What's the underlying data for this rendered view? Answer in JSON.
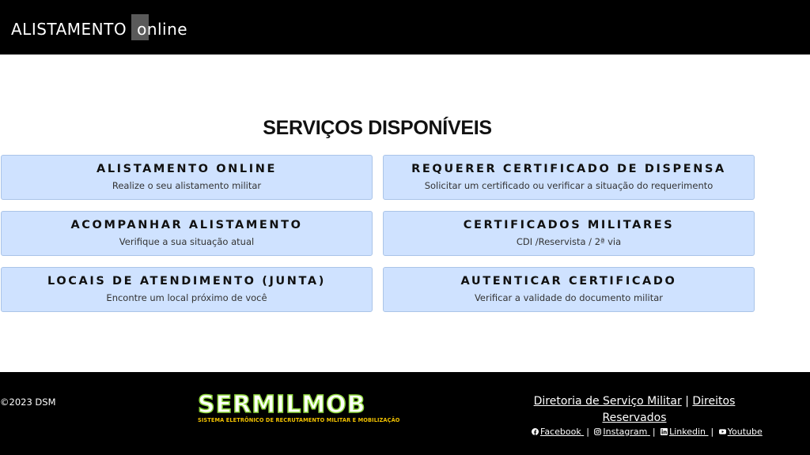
{
  "header": {
    "brand_main": "ALISTAMENTO",
    "brand_online": "online"
  },
  "main": {
    "section_title": "SERVIÇOS DISPONÍVEIS",
    "services": [
      {
        "title": "ALISTAMENTO ONLINE",
        "subtitle": "Realize o seu alistamento militar"
      },
      {
        "title": "REQUERER CERTIFICADO DE DISPENSA",
        "subtitle": "Solicitar um certificado ou verificar a situação do requerimento"
      },
      {
        "title": "ACOMPANHAR ALISTAMENTO",
        "subtitle": "Verifique a sua situação atual"
      },
      {
        "title": "CERTIFICADOS MILITARES",
        "subtitle": "CDI /Reservista / 2ª via"
      },
      {
        "title": "LOCAIS DE ATENDIMENTO (JUNTA)",
        "subtitle": "Encontre um local próximo de você"
      },
      {
        "title": "AUTENTICAR CERTIFICADO",
        "subtitle": "Verificar a validade do documento militar"
      }
    ]
  },
  "footer": {
    "copyright": "©2023 DSM",
    "logo_text": "SERMILMOB",
    "logo_subtitle": "SISTEMA ELETRÔNICO DE RECRUTAMENTO MILITAR E MOBILIZAÇÃO",
    "link_dsm": "Diretoria de Serviço Militar",
    "separator": "|",
    "link_rights": "Direitos Reservados",
    "social": {
      "facebook": "Facebook",
      "instagram": "Instagram",
      "linkedin": "Linkedin",
      "youtube": "Youtube"
    }
  },
  "colors": {
    "card_bg": "#cfe2ff",
    "logo_green": "#8cd43a",
    "logo_yellow": "#f2c200"
  }
}
